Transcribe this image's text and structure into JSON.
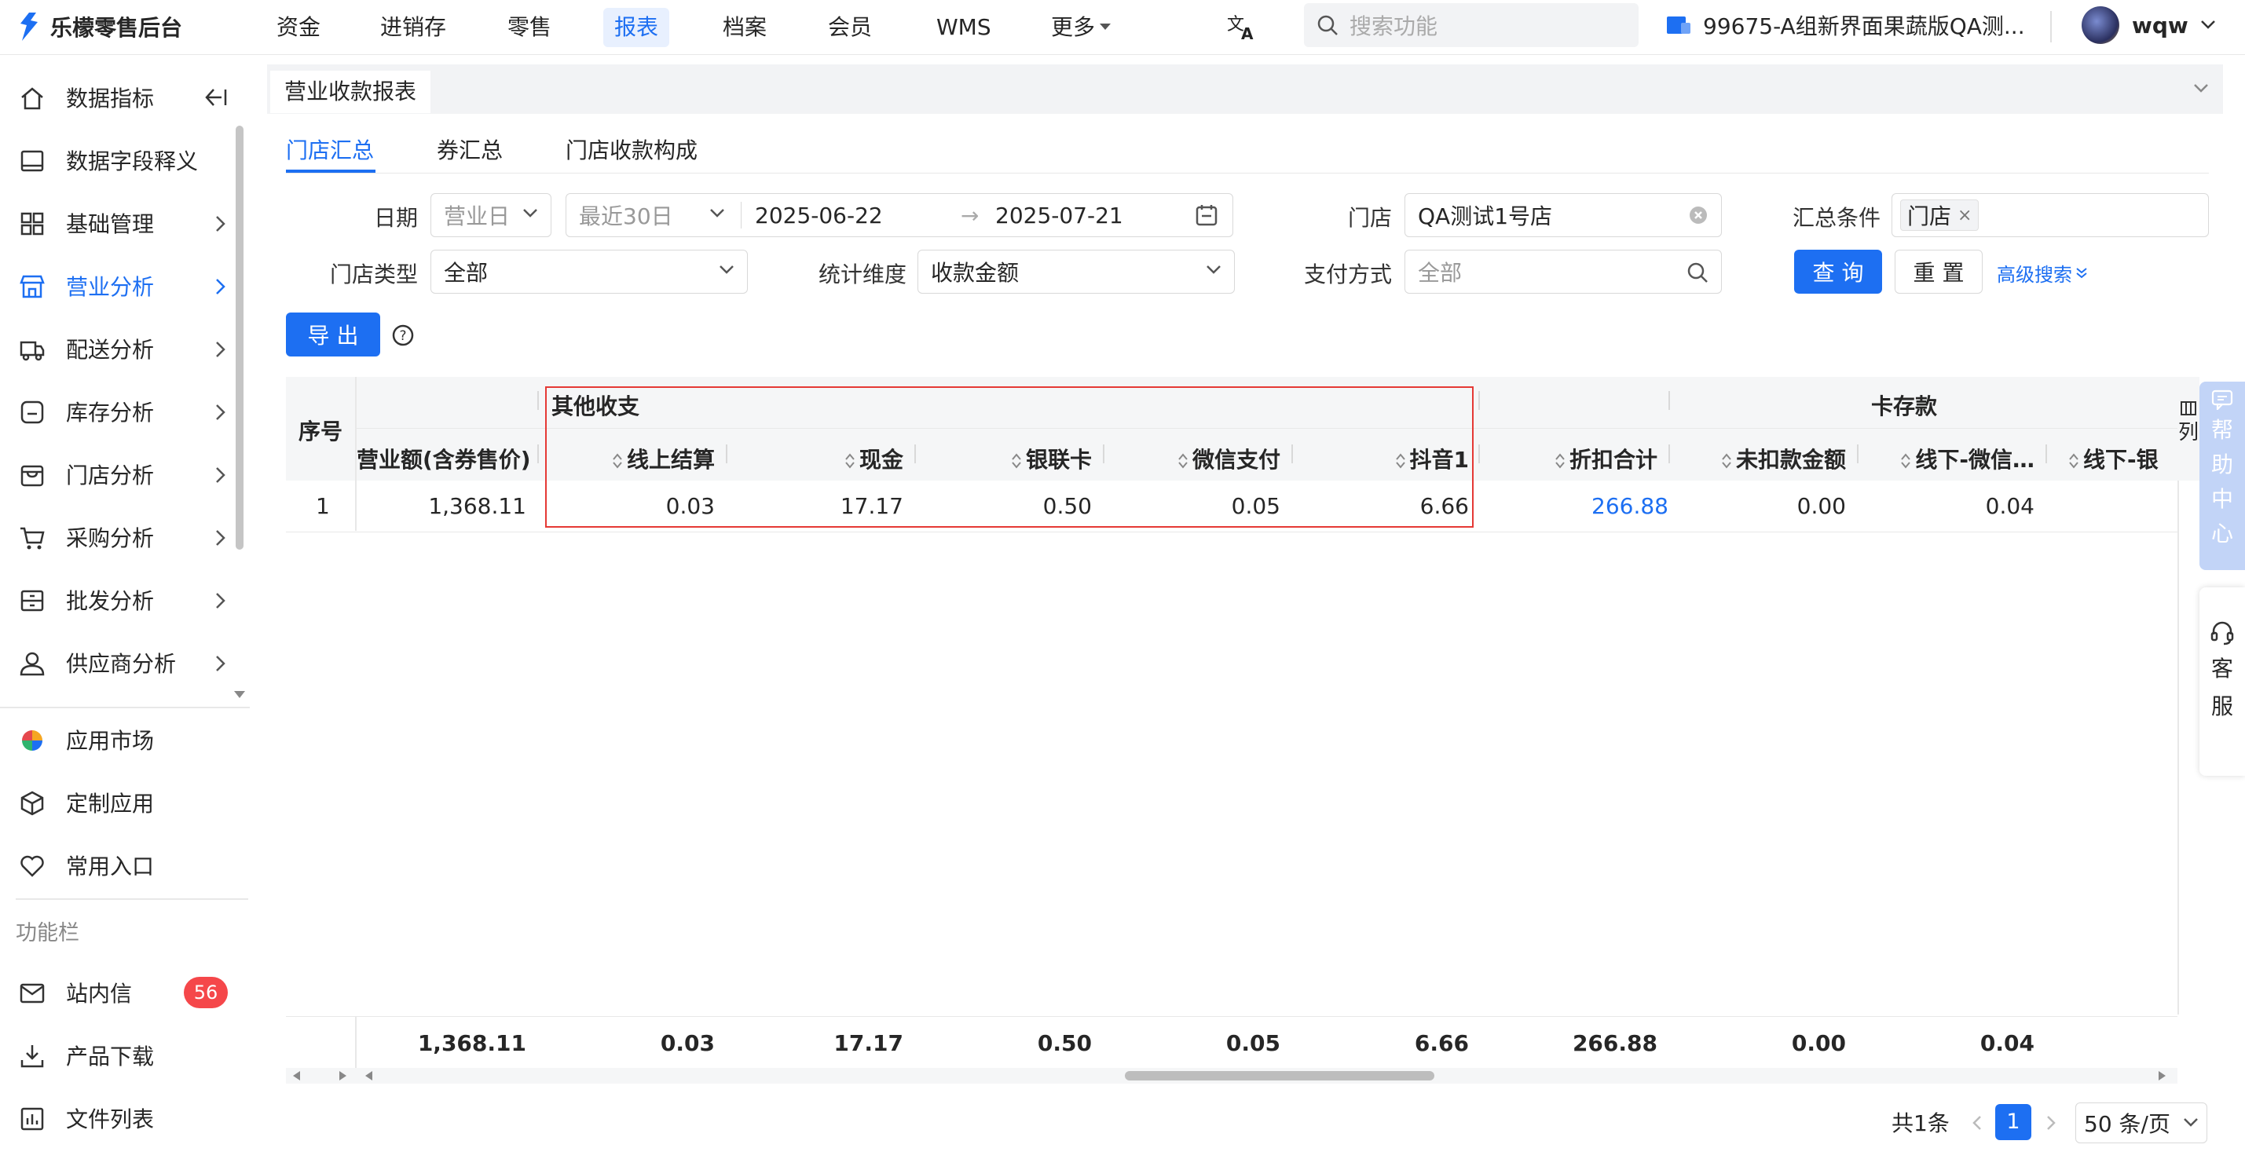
{
  "topnav": {
    "logo_text": "乐檬零售后台",
    "items": [
      "资金",
      "进销存",
      "零售",
      "报表",
      "档案",
      "会员",
      "WMS",
      "更多"
    ],
    "active": "报表",
    "search_placeholder": "搜索功能",
    "store": "99675-A组新界面果蔬版QA测...",
    "user": "wqw"
  },
  "sidebar": {
    "items": [
      "数据指标",
      "数据字段释义",
      "基础管理",
      "营业分析",
      "配送分析",
      "库存分析",
      "门店分析",
      "采购分析",
      "批发分析",
      "供应商分析"
    ],
    "active": "营业分析",
    "apps": [
      "应用市场",
      "定制应用",
      "常用入口"
    ],
    "section_title": "功能栏",
    "tools": [
      "站内信",
      "产品下载",
      "文件列表"
    ],
    "inbox_badge": "56"
  },
  "page": {
    "tab_title": "营业收款报表",
    "subtabs": [
      "门店汇总",
      "券汇总",
      "门店收款构成"
    ],
    "active_subtab": "门店汇总"
  },
  "filters": {
    "date_label": "日期",
    "date_type": "营业日",
    "date_range": "最近30日",
    "date_start": "2025-06-22",
    "date_end": "2025-07-21",
    "store_label": "门店",
    "store_value": "QA测试1号店",
    "summary_label": "汇总条件",
    "summary_tag": "门店",
    "store_type_label": "门店类型",
    "store_type_value": "全部",
    "dimension_label": "统计维度",
    "dimension_value": "收款金额",
    "pay_label": "支付方式",
    "pay_placeholder": "全部",
    "query_btn": "查 询",
    "reset_btn": "重 置",
    "advanced": "高级搜索",
    "export_btn": "导 出"
  },
  "table": {
    "seq_header": "序号",
    "group_headers": [
      "其他收支",
      "卡存款"
    ],
    "columns": [
      "营业额(含券售价)",
      "线上结算",
      "现金",
      "银联卡",
      "微信支付",
      "抖音1",
      "折扣合计",
      "未扣款金额",
      "线下-微信…",
      "线下-银"
    ],
    "rows": [
      {
        "seq": "1",
        "values": [
          "1,368.11",
          "0.03",
          "17.17",
          "0.50",
          "0.05",
          "6.66",
          "266.88",
          "0.00",
          "0.04",
          ""
        ]
      }
    ],
    "totals": [
      "1,368.11",
      "0.03",
      "17.17",
      "0.50",
      "0.05",
      "6.66",
      "266.88",
      "0.00",
      "0.04",
      ""
    ],
    "col_settings": "列"
  },
  "float": {
    "help": [
      "帮",
      "助",
      "中",
      "心"
    ],
    "service": [
      "客",
      "服"
    ]
  },
  "pagination": {
    "total": "共1条",
    "current": "1",
    "page_size": "50 条/页"
  },
  "colors": {
    "accent": "#1d6ff2",
    "highlight_box": "#e53935",
    "badge": "#f5474a"
  }
}
